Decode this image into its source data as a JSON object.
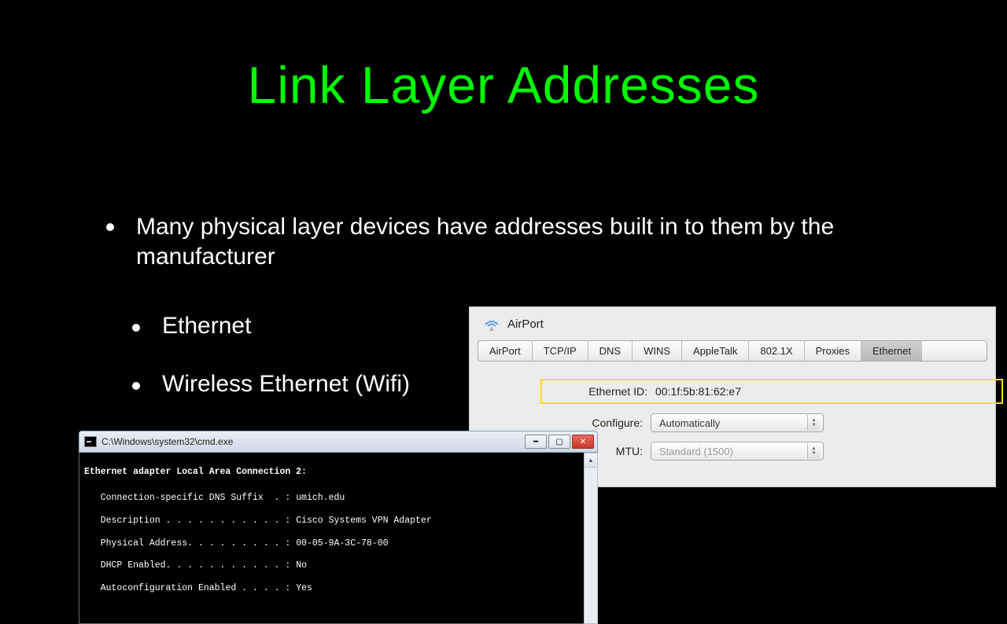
{
  "slide": {
    "title": "Link Layer Addresses",
    "bullet1": "Many physical layer devices have addresses built in to them by the manufacturer",
    "bullet2": "Ethernet",
    "bullet3": "Wireless Ethernet (Wifi)"
  },
  "mac": {
    "app_title": "AirPort",
    "tabs": [
      "AirPort",
      "TCP/IP",
      "DNS",
      "WINS",
      "AppleTalk",
      "802.1X",
      "Proxies",
      "Ethernet"
    ],
    "ethernet_id_label": "Ethernet ID:",
    "ethernet_id_value": "00:1f:5b:81:62:e7",
    "configure_label": "Configure:",
    "configure_value": "Automatically",
    "mtu_label": "MTU:",
    "mtu_value": "Standard (1500)"
  },
  "win": {
    "title": "C:\\Windows\\system32\\cmd.exe",
    "header": "Ethernet adapter Local Area Connection 2:",
    "lines": [
      {
        "label": "Connection-specific DNS Suffix  .",
        "value": "umich.edu"
      },
      {
        "label": "Description . . . . . . . . . . .",
        "value": "Cisco Systems VPN Adapter"
      },
      {
        "label": "Physical Address. . . . . . . . .",
        "value": "00-05-9A-3C-78-00"
      },
      {
        "label": "DHCP Enabled. . . . . . . . . . .",
        "value": "No"
      },
      {
        "label": "Autoconfiguration Enabled . . . .",
        "value": "Yes"
      }
    ]
  }
}
